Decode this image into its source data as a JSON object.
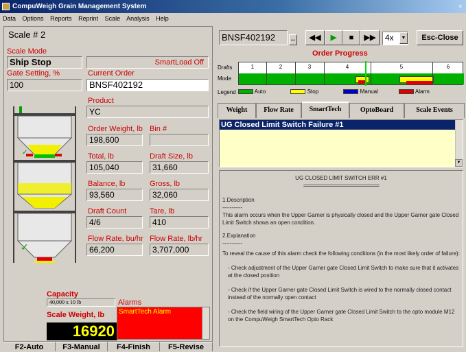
{
  "window": {
    "title": "CompuWeigh Grain Management System"
  },
  "menu": [
    "Data",
    "Options",
    "Reports",
    "Reprint",
    "Scale",
    "Analysis",
    "Help"
  ],
  "scale": {
    "name": "Scale # 2",
    "mode_label": "Scale Mode",
    "mode_value": "Ship Stop",
    "smartload": "SmartLoad Off",
    "gate_label": "Gate Setting, %",
    "gate_value": "100",
    "current_order_label": "Current Order",
    "current_order_value": "BNSF402192",
    "product_label": "Product",
    "product_value": "YC",
    "order_weight_label": "Order Weight, lb",
    "order_weight_value": "198,600",
    "bin_label": "Bin #",
    "bin_value": "",
    "total_label": "Total, lb",
    "total_value": "105,040",
    "draft_size_label": "Draft Size, lb",
    "draft_size_value": "31,660",
    "balance_label": "Balance, lb",
    "balance_value": "93,560",
    "gross_label": "Gross, lb",
    "gross_value": "32,060",
    "draft_count_label": "Draft Count",
    "draft_count_value": "4/6",
    "tare_label": "Tare, lb",
    "tare_value": "410",
    "flow_bu_label": "Flow Rate, bu/hr",
    "flow_bu_value": "66,200",
    "flow_lb_label": "Flow Rate, lb/hr",
    "flow_lb_value": "3,707,000",
    "capacity_label": "Capacity",
    "capacity_value": "40,000 x 10 lb",
    "scale_weight_label": "Scale Weight, lb",
    "scale_weight_value": "16920",
    "alarms_label": "Alarms",
    "alarm_text": "SmartTech Alarm"
  },
  "function_keys": [
    "F2-Auto",
    "F3-Manual",
    "F4-Finish",
    "F5-Revise"
  ],
  "order_bar": {
    "order_value": "BNSF402192",
    "dropdown_btn": "...",
    "rewind": "◀◀",
    "play": "▶",
    "stop": "■",
    "ffwd": "▶▶",
    "speed": "4x",
    "esc": "Esc-Close"
  },
  "progress": {
    "title": "Order Progress",
    "drafts_label": "Drafts",
    "mode_label": "Mode",
    "legend_label": "Legend",
    "draft_numbers": [
      "1",
      "2",
      "3",
      "4",
      "5",
      "6"
    ],
    "legend": [
      {
        "name": "Auto",
        "color": "#00b000"
      },
      {
        "name": "Stop",
        "color": "#ffff00"
      },
      {
        "name": "Manual",
        "color": "#0000cc"
      },
      {
        "name": "Alarm",
        "color": "#e00000"
      }
    ]
  },
  "tabs": [
    "Weight",
    "Flow Rate",
    "SmartTech",
    "OptoBoard",
    "Scale Events"
  ],
  "selected_tab": "SmartTech",
  "alarm_list": [
    "UG Closed Limit Switch Failure #1"
  ],
  "doc": {
    "heading": "UG CLOSED LIMIT SWITCH ERR #1",
    "rule": "==============================",
    "s1_title": "1.Description",
    "s1_dash": "-----------",
    "s1_text": "This alarm occurs when the Upper Garner is physically closed and the Upper Garner gate Closed Limit Switch shows an open condition.",
    "s2_title": "2.Explanation",
    "s2_dash": "-----------",
    "s2_intro": "To reveal the cause of this alarm check the following conditions (in the most likely order of failure):",
    "items": [
      "- Check adjustment of the Upper Garner gate Closed Limit Switch to make sure that it activates at the closed position",
      "- Check if the Upper Garner gate Closed Limit Switch is wired to the normally closed contact instead of the normally open contact",
      "- Check the field wiring of the Upper Garner gate Closed Limit Switch to the opto module M12 on the CompuWeigh SmartTech Opto Rack"
    ]
  }
}
